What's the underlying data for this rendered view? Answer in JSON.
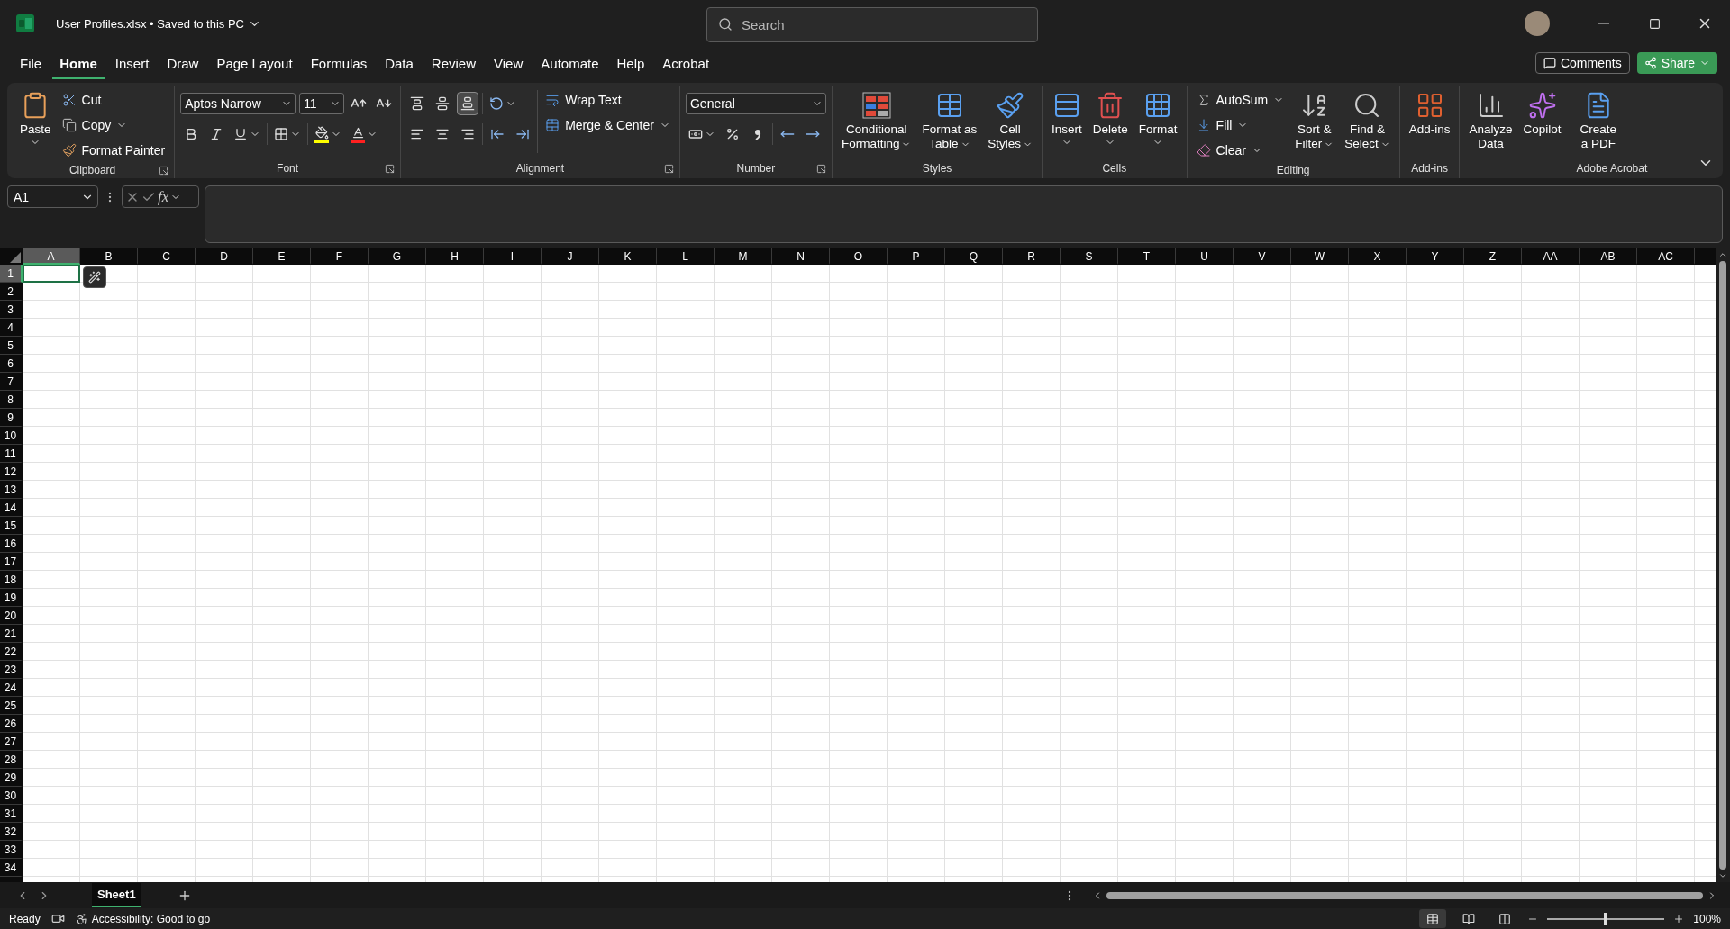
{
  "title_bar": {
    "file_title": "User Profiles.xlsx • Saved to this PC",
    "search": {
      "placeholder": "Search"
    }
  },
  "menu_tabs": [
    {
      "label": "File",
      "selected": false
    },
    {
      "label": "Home",
      "selected": true
    },
    {
      "label": "Insert",
      "selected": false
    },
    {
      "label": "Draw",
      "selected": false
    },
    {
      "label": "Page Layout",
      "selected": false
    },
    {
      "label": "Formulas",
      "selected": false
    },
    {
      "label": "Data",
      "selected": false
    },
    {
      "label": "Review",
      "selected": false
    },
    {
      "label": "View",
      "selected": false
    },
    {
      "label": "Automate",
      "selected": false
    },
    {
      "label": "Help",
      "selected": false
    },
    {
      "label": "Acrobat",
      "selected": false
    }
  ],
  "comments_button": "Comments",
  "share_button": "Share",
  "ribbon": [
    {
      "kind": "buttons",
      "label": "Clipboard",
      "launcher": true,
      "buttons": [
        {
          "kind": "large",
          "lines": [
            "Paste"
          ],
          "menu": true
        },
        {
          "kind": "small",
          "lines": [
            "Cut"
          ],
          "menu": false
        },
        {
          "kind": "small",
          "lines": [
            "Copy"
          ],
          "menu": true
        },
        {
          "kind": "small",
          "lines": [
            "Format Painter"
          ],
          "menu": false
        }
      ]
    },
    {
      "kind": "font",
      "label": "Font",
      "launcher": true,
      "font_name": "Aptos Narrow",
      "font_size": "11"
    },
    {
      "kind": "alignment",
      "label": "Alignment",
      "launcher": true,
      "vertical_align": [
        {
          "selected": false
        },
        {
          "selected": false
        },
        {
          "selected": true
        }
      ],
      "buttons": [
        {
          "kind": "small",
          "lines": [
            "Wrap Text"
          ],
          "menu": false
        },
        {
          "kind": "small",
          "lines": [
            "Merge & Center"
          ],
          "menu": true
        }
      ]
    },
    {
      "kind": "number",
      "label": "Number",
      "launcher": true,
      "format": "General"
    },
    {
      "kind": "buttons",
      "label": "Styles",
      "launcher": false,
      "buttons": [
        {
          "kind": "large",
          "lines": [
            "Conditional",
            "Formatting"
          ],
          "menu": true
        },
        {
          "kind": "large",
          "lines": [
            "Format as",
            "Table"
          ],
          "menu": true
        },
        {
          "kind": "large",
          "lines": [
            "Cell",
            "Styles"
          ],
          "menu": true
        }
      ]
    },
    {
      "kind": "buttons",
      "label": "Cells",
      "launcher": false,
      "buttons": [
        {
          "kind": "large",
          "lines": [
            "Insert"
          ],
          "menu": true
        },
        {
          "kind": "large",
          "lines": [
            "Delete"
          ],
          "menu": true
        },
        {
          "kind": "large",
          "lines": [
            "Format"
          ],
          "menu": true
        }
      ]
    },
    {
      "kind": "buttons",
      "label": "Editing",
      "launcher": false,
      "buttons": [
        {
          "kind": "small",
          "lines": [
            "AutoSum"
          ],
          "menu": true
        },
        {
          "kind": "small",
          "lines": [
            "Fill"
          ],
          "menu": true
        },
        {
          "kind": "small",
          "lines": [
            "Clear"
          ],
          "menu": true
        },
        {
          "kind": "large",
          "lines": [
            "Sort &",
            "Filter"
          ],
          "menu": true
        },
        {
          "kind": "large",
          "lines": [
            "Find &",
            "Select"
          ],
          "menu": true
        }
      ]
    },
    {
      "kind": "buttons",
      "label": "Add-ins",
      "launcher": false,
      "buttons": [
        {
          "kind": "large",
          "lines": [
            "Add-ins"
          ],
          "menu": false
        }
      ]
    },
    {
      "kind": "buttons",
      "launcher": false,
      "buttons": [
        {
          "kind": "large",
          "lines": [
            "Analyze",
            "Data"
          ],
          "menu": false
        },
        {
          "kind": "large",
          "lines": [
            "Copilot"
          ],
          "menu": false
        }
      ]
    },
    {
      "kind": "buttons",
      "label": "Adobe Acrobat",
      "launcher": false,
      "buttons": [
        {
          "kind": "large",
          "lines": [
            "Create",
            "a PDF"
          ],
          "menu": false
        }
      ]
    }
  ],
  "formula_bar": {
    "name_box": "A1",
    "function_label": "fx"
  },
  "columns": [
    {
      "label": "A",
      "selected": true
    },
    {
      "label": "B",
      "selected": false
    },
    {
      "label": "C",
      "selected": false
    },
    {
      "label": "D",
      "selected": false
    },
    {
      "label": "E",
      "selected": false
    },
    {
      "label": "F",
      "selected": false
    },
    {
      "label": "G",
      "selected": false
    },
    {
      "label": "H",
      "selected": false
    },
    {
      "label": "I",
      "selected": false
    },
    {
      "label": "J",
      "selected": false
    },
    {
      "label": "K",
      "selected": false
    },
    {
      "label": "L",
      "selected": false
    },
    {
      "label": "M",
      "selected": false
    },
    {
      "label": "N",
      "selected": false
    },
    {
      "label": "O",
      "selected": false
    },
    {
      "label": "P",
      "selected": false
    },
    {
      "label": "Q",
      "selected": false
    },
    {
      "label": "R",
      "selected": false
    },
    {
      "label": "S",
      "selected": false
    },
    {
      "label": "T",
      "selected": false
    },
    {
      "label": "U",
      "selected": false
    },
    {
      "label": "V",
      "selected": false
    },
    {
      "label": "W",
      "selected": false
    },
    {
      "label": "X",
      "selected": false
    },
    {
      "label": "Y",
      "selected": false
    },
    {
      "label": "Z",
      "selected": false
    },
    {
      "label": "AA",
      "selected": false
    },
    {
      "label": "AB",
      "selected": false
    },
    {
      "label": "AC",
      "selected": false
    }
  ],
  "rows": [
    {
      "label": "1",
      "selected": true
    },
    {
      "label": "2",
      "selected": false
    },
    {
      "label": "3",
      "selected": false
    },
    {
      "label": "4",
      "selected": false
    },
    {
      "label": "5",
      "selected": false
    },
    {
      "label": "6",
      "selected": false
    },
    {
      "label": "7",
      "selected": false
    },
    {
      "label": "8",
      "selected": false
    },
    {
      "label": "9",
      "selected": false
    },
    {
      "label": "10",
      "selected": false
    },
    {
      "label": "11",
      "selected": false
    },
    {
      "label": "12",
      "selected": false
    },
    {
      "label": "13",
      "selected": false
    },
    {
      "label": "14",
      "selected": false
    },
    {
      "label": "15",
      "selected": false
    },
    {
      "label": "16",
      "selected": false
    },
    {
      "label": "17",
      "selected": false
    },
    {
      "label": "18",
      "selected": false
    },
    {
      "label": "19",
      "selected": false
    },
    {
      "label": "20",
      "selected": false
    },
    {
      "label": "21",
      "selected": false
    },
    {
      "label": "22",
      "selected": false
    },
    {
      "label": "23",
      "selected": false
    },
    {
      "label": "24",
      "selected": false
    },
    {
      "label": "25",
      "selected": false
    },
    {
      "label": "26",
      "selected": false
    },
    {
      "label": "27",
      "selected": false
    },
    {
      "label": "28",
      "selected": false
    },
    {
      "label": "29",
      "selected": false
    },
    {
      "label": "30",
      "selected": false
    },
    {
      "label": "31",
      "selected": false
    },
    {
      "label": "32",
      "selected": false
    },
    {
      "label": "33",
      "selected": false
    },
    {
      "label": "34",
      "selected": false
    }
  ],
  "sheet_tabs": [
    {
      "label": "Sheet1",
      "selected": true
    }
  ],
  "status_bar": {
    "ready": "Ready",
    "accessibility": "Accessibility: Good to go",
    "views": [
      {
        "selected": true
      },
      {
        "selected": false
      },
      {
        "selected": false
      }
    ],
    "zoom": {
      "level": 0.5,
      "reading": "100%"
    }
  }
}
